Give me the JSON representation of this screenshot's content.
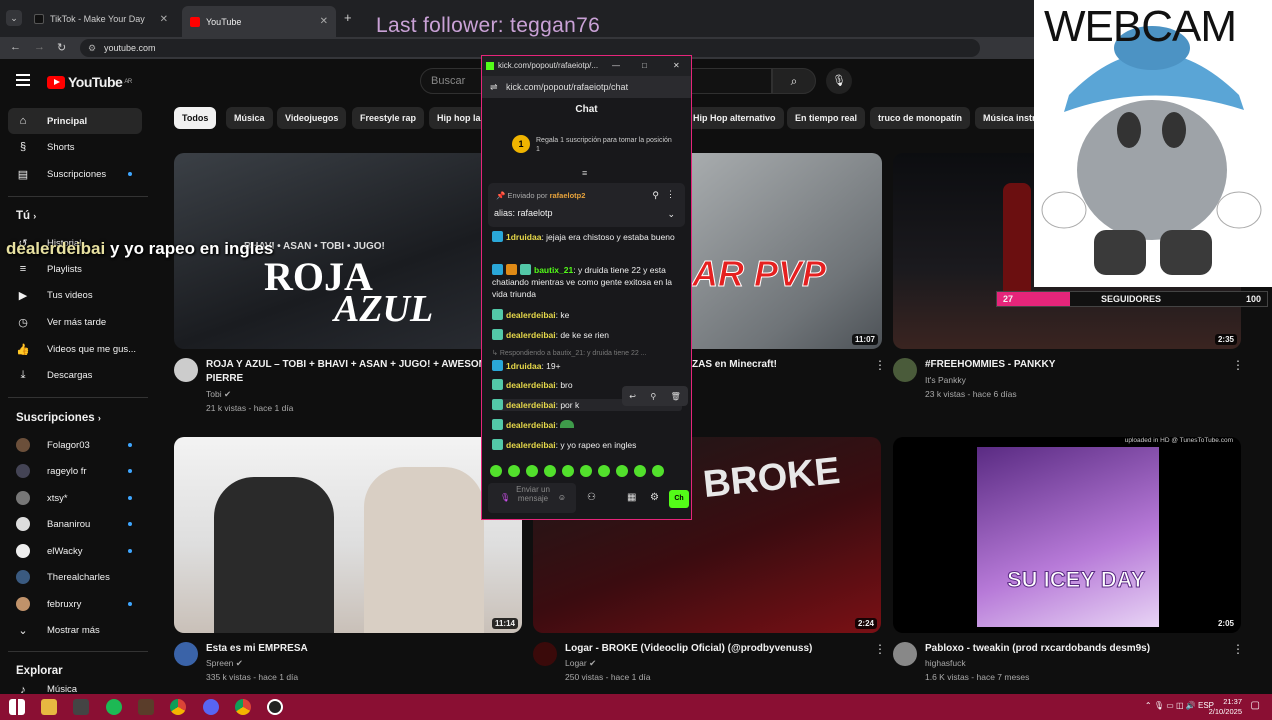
{
  "browser": {
    "tabs": [
      {
        "label": "TikTok - Make Your Day"
      },
      {
        "label": "YouTube"
      }
    ],
    "url": "youtube.com"
  },
  "youtube": {
    "logo_text": "YouTube",
    "region": "AR",
    "search_placeholder": "Buscar",
    "sidebar": {
      "main": [
        {
          "label": "Principal",
          "icon": "home-icon"
        },
        {
          "label": "Shorts",
          "icon": "shorts-icon"
        },
        {
          "label": "Suscripciones",
          "icon": "subscriptions-icon"
        }
      ],
      "you_heading": "Tú",
      "you": [
        {
          "label": "Historial",
          "icon": "history-icon"
        },
        {
          "label": "Playlists",
          "icon": "playlist-icon"
        },
        {
          "label": "Tus videos",
          "icon": "your-videos-icon"
        },
        {
          "label": "Ver más tarde",
          "icon": "watch-later-icon"
        },
        {
          "label": "Videos que me gus...",
          "icon": "like-icon"
        },
        {
          "label": "Descargas",
          "icon": "download-icon"
        }
      ],
      "subs_heading": "Suscripciones",
      "subs": [
        {
          "label": "Folagor03"
        },
        {
          "label": "rageylo fr"
        },
        {
          "label": "xtsy*"
        },
        {
          "label": "Bananirou"
        },
        {
          "label": "elWacky"
        },
        {
          "label": "Therealcharles"
        },
        {
          "label": "februxry"
        }
      ],
      "show_more": "Mostrar más",
      "explore_heading": "Explorar",
      "explore_first": "Música"
    },
    "chips": [
      "Todos",
      "Música",
      "Videojuegos",
      "Freestyle rap",
      "Hip hop la",
      "Hip Hop alternativo",
      "En tiempo real",
      "truco de monopatín",
      "Música instr"
    ],
    "videos": [
      {
        "title_1": "ROJA Y AZUL – TOBI + BHAVI + ASAN + JUGO! + AWESOM",
        "title_2": "PIERRE",
        "channel": "Tobi",
        "stats": "21 k vistas - hace 1 día",
        "duration": ""
      },
      {
        "title_1": "ZAS en Minecraft!",
        "title_2": "",
        "channel": "",
        "stats": "",
        "duration": "11:07"
      },
      {
        "title_1": "#FREEHOMMIES - PANKKY",
        "title_2": "",
        "channel": "It's Pankky",
        "stats": "23 k vistas - hace 6 días",
        "duration": "2:35"
      },
      {
        "title_1": "Esta es mi EMPRESA",
        "title_2": "",
        "channel": "Spreen",
        "stats": "335 k vistas - hace 1 día",
        "duration": "11:14"
      },
      {
        "title_1": "Logar - BROKE (Videoclip Oficial) (@prodbyvenuss)",
        "title_2": "",
        "channel": "Logar",
        "stats": "250 vistas - hace 1 día",
        "duration": "2:24"
      },
      {
        "title_1": "Pabloxo - tweakin (prod rxcardobands desm9s)",
        "title_2": "",
        "channel": "highasfuck",
        "stats": "1.6 K vistas - hace 7 meses",
        "duration": "2:05"
      }
    ],
    "thumb_text": {
      "v1_big": "ROJA",
      "v1_big2": "AZUL",
      "v1_names": "BHAVI • ASAN • TOBI • JUGO!",
      "v2_big": "AR PVP",
      "v5_big": "BROKE",
      "v6_small": "uploaded in HD @ TunesToTube.com",
      "v6_big": "SU ICEY DAY"
    }
  },
  "overlay": {
    "last_follower": "Last follower: teggan76",
    "chat_user": "dealerdeibai",
    "chat_text": " y yo rapeo en ingles",
    "webcam_label": "WEBCAM",
    "followers_current": "27",
    "followers_label": "SEGUIDORES",
    "followers_goal": "100",
    "followers_progress": 0.27
  },
  "kick": {
    "window_title": "kick.com/popout/rafaeiotp/...",
    "url": "kick.com/popout/rafaeiotp/chat",
    "header": "Chat",
    "sub_text": "Regala 1 suscripción para tomar la posición 1",
    "sub_position": "1",
    "pinned_by_prefix": "Enviado por ",
    "pinned_by_user": "rafaelotp2",
    "pinned_message": "alias: rafaelotp",
    "messages": [
      {
        "user": "1druidaa",
        "text": ": jejaja era chistoso y estaba bueno",
        "color": "#e6d84a"
      },
      {
        "user": "bautix_21",
        "text": ": y druida tiene 22 y esta chatiando mientras ve como gente exitosa en la vida triunda",
        "color": "#53fc18"
      },
      {
        "user": "dealerdeibai",
        "text": ": ke",
        "color": "#e6d84a"
      },
      {
        "user": "dealerdeibai",
        "text": ": de ke se rien",
        "color": "#e6d84a"
      },
      {
        "user": "",
        "text": "Respondiendo a bautix_21: y druida tiene 22 ...",
        "color": "#777"
      },
      {
        "user": "1druidaa",
        "text": ": 19+",
        "color": "#e6d84a"
      },
      {
        "user": "dealerdeibai",
        "text": ": bro",
        "color": "#e6d84a"
      },
      {
        "user": "dealerdeibai",
        "text": ": por k",
        "color": "#e6d84a"
      },
      {
        "user": "dealerdeibai",
        "text": ":",
        "color": "#e6d84a"
      },
      {
        "user": "dealerdeibai",
        "text": ": y yo rapeo en ingles",
        "color": "#e6d84a"
      }
    ],
    "input_placeholder": "Enviar un mensaje",
    "send_label": "Ch"
  },
  "taskbar": {
    "lang": "ESP",
    "time": "21:37",
    "date": "2/10/2025"
  }
}
